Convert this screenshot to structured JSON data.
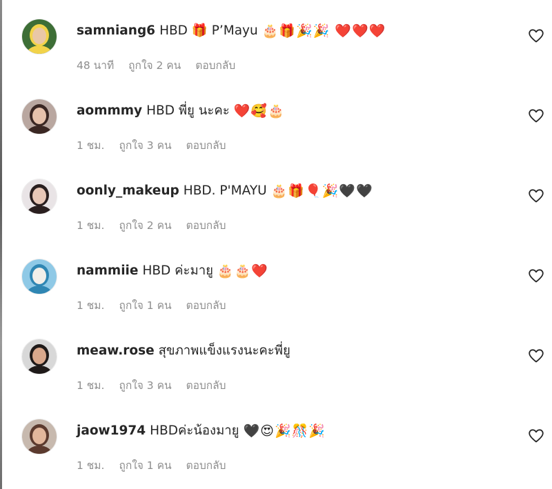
{
  "comments": [
    {
      "username": "samniang6",
      "text": "HBD 🎁 P’Mayu",
      "emojis": "🎂🎁🎉🎉 ❤️❤️❤️",
      "time": "48 นาที",
      "likes": "ถูกใจ 2 คน",
      "reply": "ตอบกลับ",
      "avatar": {
        "bg": "#3d6e36",
        "face": "#e9c7a6",
        "accent": "#f2d34a",
        "icon": "avatar-photo"
      }
    },
    {
      "username": "aommmy",
      "text": "HBD พี่ยู นะคะ",
      "emojis": "❤️🥰🎂",
      "time": "1 ชม.",
      "likes": "ถูกใจ 3 คน",
      "reply": "ตอบกลับ",
      "avatar": {
        "bg": "#b9a7a0",
        "face": "#e6c2ac",
        "accent": "#3a2723",
        "icon": "avatar-photo"
      }
    },
    {
      "username": "oonly_makeup",
      "text": "HBD. P'MAYU",
      "emojis": "🎂🎁🎈🎉🖤🖤",
      "time": "1 ชม.",
      "likes": "ถูกใจ 2 คน",
      "reply": "ตอบกลับ",
      "avatar": {
        "bg": "#e9e4e6",
        "face": "#e8c7b7",
        "accent": "#2a1f1f",
        "icon": "avatar-photo"
      }
    },
    {
      "username": "nammiie",
      "text": "HBD ค่ะมายู",
      "emojis": "🎂🎂❤️",
      "time": "1 ชม.",
      "likes": "ถูกใจ 1 คน",
      "reply": "ตอบกลับ",
      "avatar": {
        "bg": "#8fc9e6",
        "face": "#f2efe9",
        "accent": "#2f86b3",
        "icon": "avatar-photo"
      }
    },
    {
      "username": "meaw.rose",
      "text": "สุขภาพแข็งแรงนะคะพี่ยู",
      "emojis": "",
      "time": "1 ชม.",
      "likes": "ถูกใจ 3 คน",
      "reply": "ตอบกลับ",
      "avatar": {
        "bg": "#d8d8d8",
        "face": "#d9a88c",
        "accent": "#1f1a19",
        "icon": "avatar-photo"
      }
    },
    {
      "username": "jaow1974",
      "text": "HBDค่ะน้องมายู",
      "emojis": "🖤😍🎉🎊🎉",
      "time": "1 ชม.",
      "likes": "ถูกใจ 1 คน",
      "reply": "ตอบกลับ",
      "avatar": {
        "bg": "#c7b9ae",
        "face": "#e2b79c",
        "accent": "#5b3a2e",
        "icon": "avatar-photo"
      }
    }
  ],
  "icons": {
    "like": "heart-outline-icon"
  },
  "colors": {
    "text": "#262626",
    "meta": "#8e8e8e",
    "heart": "#262626"
  }
}
